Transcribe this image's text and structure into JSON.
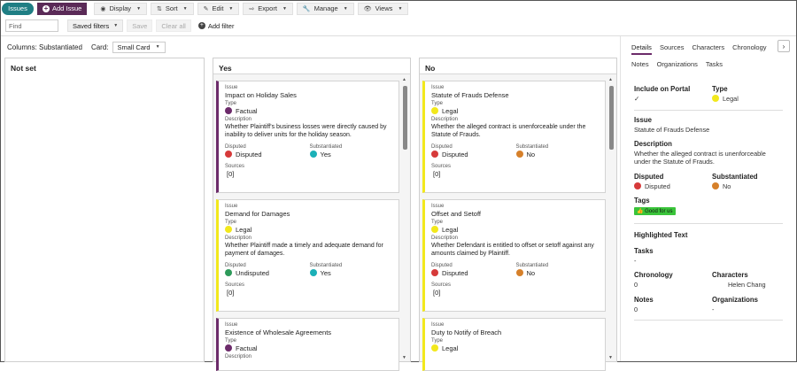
{
  "toolbar": {
    "issues_tab": "Issues",
    "add_issue": "Add Issue",
    "display": "Display",
    "sort": "Sort",
    "edit": "Edit",
    "export": "Export",
    "manage": "Manage",
    "views": "Views"
  },
  "filterbar": {
    "find_placeholder": "Find",
    "saved_filters": "Saved filters",
    "save": "Save",
    "clear_all": "Clear all",
    "add_filter": "Add filter"
  },
  "board": {
    "columns_label": "Columns: Substantiated",
    "card_label": "Card:",
    "card_value": "Small Card",
    "lanes": [
      {
        "title": "Not set",
        "cards": []
      },
      {
        "title": "Yes",
        "cards": [
          {
            "issue_label": "Issue",
            "issue": "Impact on Holiday Sales",
            "type_label": "Type",
            "type": "Factual",
            "type_color": "#6c2b6a",
            "desc_label": "Description",
            "desc": "Whether Plaintiff's business losses were directly caused by inability to deliver units for the holiday season.",
            "disputed_label": "Disputed",
            "disputed": "Disputed",
            "disputed_color": "#d63a3a",
            "subst_label": "Substantiated",
            "subst": "Yes",
            "subst_color": "#1bb0b7",
            "sources_label": "Sources",
            "sources": "[0]"
          },
          {
            "issue_label": "Issue",
            "issue": "Demand for Damages",
            "type_label": "Type",
            "type": "Legal",
            "type_color": "#f2e81c",
            "desc_label": "Description",
            "desc": "Whether Plaintiff made a timely and adequate demand for payment of damages.",
            "disputed_label": "Disputed",
            "disputed": "Undisputed",
            "disputed_color": "#2e9a5a",
            "subst_label": "Substantiated",
            "subst": "Yes",
            "subst_color": "#1bb0b7",
            "sources_label": "Sources",
            "sources": "[0]"
          },
          {
            "issue_label": "Issue",
            "issue": "Existence of Wholesale Agreements",
            "type_label": "Type",
            "type": "Factual",
            "type_color": "#6c2b6a",
            "desc_label": "Description"
          }
        ]
      },
      {
        "title": "No",
        "cards": [
          {
            "issue_label": "Issue",
            "issue": "Statute of Frauds Defense",
            "type_label": "Type",
            "type": "Legal",
            "type_color": "#f2e81c",
            "desc_label": "Description",
            "desc": "Whether the alleged contract is unenforceable under the Statute of Frauds.",
            "disputed_label": "Disputed",
            "disputed": "Disputed",
            "disputed_color": "#d63a3a",
            "subst_label": "Substantiated",
            "subst": "No",
            "subst_color": "#d6802a",
            "sources_label": "Sources",
            "sources": "[0]"
          },
          {
            "issue_label": "Issue",
            "issue": "Offset and Setoff",
            "type_label": "Type",
            "type": "Legal",
            "type_color": "#f2e81c",
            "desc_label": "Description",
            "desc": "Whether Defendant is entitled to offset or setoff against any amounts claimed by Plaintiff.",
            "disputed_label": "Disputed",
            "disputed": "Disputed",
            "disputed_color": "#d63a3a",
            "subst_label": "Substantiated",
            "subst": "No",
            "subst_color": "#d6802a",
            "sources_label": "Sources",
            "sources": "[0]"
          },
          {
            "issue_label": "Issue",
            "issue": "Duty to Notify of Breach",
            "type_label": "Type",
            "type": "Legal",
            "type_color": "#f2e81c"
          }
        ]
      }
    ]
  },
  "panel": {
    "tabs": [
      "Details",
      "Sources",
      "Characters",
      "Chronology",
      "Notes",
      "Organizations",
      "Tasks"
    ],
    "include_on_portal_label": "Include on Portal",
    "include_on_portal_value": "✓",
    "type_label": "Type",
    "type_value": "Legal",
    "type_color": "#f2e81c",
    "issue_label": "Issue",
    "issue_value": "Statute of Frauds Defense",
    "description_label": "Description",
    "description_value": "Whether the alleged contract is unenforceable under the Statute of Frauds.",
    "disputed_label": "Disputed",
    "disputed_value": "Disputed",
    "disputed_color": "#d63a3a",
    "substantiated_label": "Substantiated",
    "substantiated_value": "No",
    "substantiated_color": "#d6802a",
    "tags_label": "Tags",
    "tag_value": "Good for us",
    "highlighted_label": "Highlighted Text",
    "tasks_label": "Tasks",
    "tasks_value": "-",
    "chronology_label": "Chronology",
    "chronology_value": "0",
    "characters_label": "Characters",
    "characters_value": "Helen Chang",
    "notes_label": "Notes",
    "notes_value": "0",
    "organizations_label": "Organizations",
    "organizations_value": "-"
  }
}
